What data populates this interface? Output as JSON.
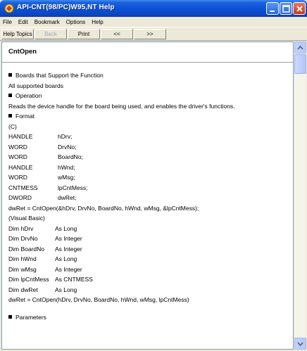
{
  "window": {
    "title": "API-CNT(98/PC)W95,NT Help"
  },
  "menu": [
    "File",
    "Edit",
    "Bookmark",
    "Options",
    "Help"
  ],
  "buttons": {
    "help_topics": "Help Topics",
    "back": "Back",
    "print": "Print",
    "prev": "<<",
    "next": ">>"
  },
  "topic": {
    "title": "CntOpen",
    "boards_heading": "Boards that Support the Function",
    "boards_text": "All supported boards",
    "operation_heading": "Operation",
    "operation_text": "Reads the device handle for the board being used, and enables the driver's functions.",
    "format_heading": "Format",
    "c_label": "(C)",
    "c_decls": [
      [
        "HANDLE",
        "hDrv;"
      ],
      [
        "WORD",
        "DrvNo;"
      ],
      [
        "WORD",
        "BoardNo;"
      ],
      [
        "HANDLE",
        "hWnd;"
      ],
      [
        "WORD",
        "wMsg;"
      ],
      [
        "CNTMESS",
        "lpCntMess;"
      ],
      [
        "DWORD",
        "dwRet;"
      ]
    ],
    "c_call": "dwRet = CntOpen(&hDrv, DrvNo, BoardNo, hWnd, wMsg, &lpCntMess);",
    "vb_label": "(Visual Basic)",
    "vb_decls": [
      [
        "Dim hDrv",
        "As Long"
      ],
      [
        "Dim DrvNo",
        "As Integer"
      ],
      [
        "Dim BoardNo",
        "As Integer"
      ],
      [
        "Dim hWnd",
        "As Long"
      ],
      [
        "Dim wMsg",
        "As Integer"
      ],
      [
        "Dim lpCntMess",
        "As CNTMESS"
      ],
      [
        "Dim dwRet",
        "As Long"
      ]
    ],
    "vb_call": "dwRet = CntOpen(hDrv, DrvNo, BoardNo, hWnd, wMsg, lpCntMess)",
    "parameters_heading": "Parameters"
  }
}
